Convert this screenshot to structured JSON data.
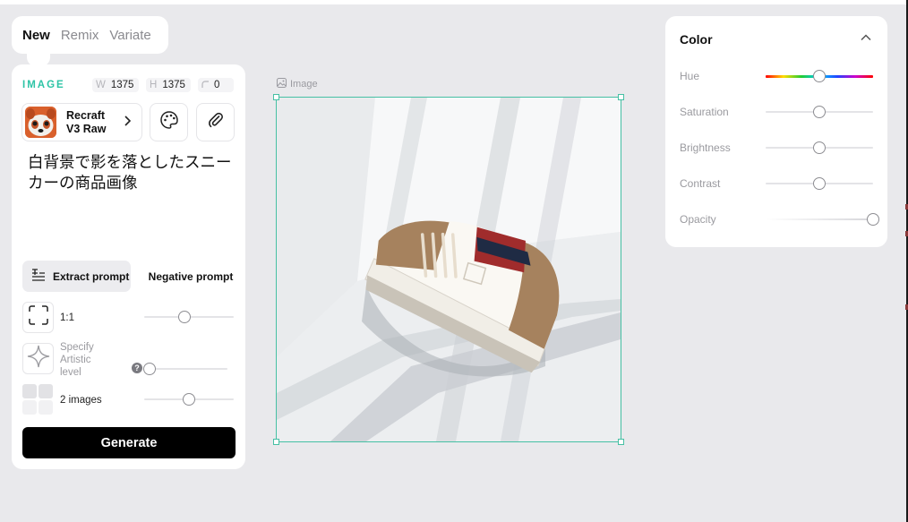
{
  "mode_tabs": [
    {
      "label": "New",
      "active": true
    },
    {
      "label": "Remix",
      "active": false
    },
    {
      "label": "Variate",
      "active": false
    }
  ],
  "image_settings": {
    "section_label": "IMAGE",
    "width_key": "W",
    "width_value": "1375",
    "height_key": "H",
    "height_value": "1375",
    "corner_value": "0"
  },
  "model": {
    "name_line1": "Recraft",
    "name_line2": "V3 Raw",
    "avatar_icon": "red-panda-avatar"
  },
  "tool_buttons": [
    {
      "icon": "palette-icon"
    },
    {
      "icon": "paperclip-icon"
    }
  ],
  "prompt_text": "白背景で影を落としたスニーカーの商品画像",
  "prompt_buttons": {
    "extract": "Extract prompt",
    "negative": "Negative prompt"
  },
  "options": {
    "aspect": {
      "label": "1:1",
      "value": 0.45
    },
    "artistic": {
      "label": "Specify Artistic level",
      "help": "?",
      "value": 0.0
    },
    "count": {
      "label": "2 images",
      "value": 0.5
    }
  },
  "generate_label": "Generate",
  "canvas": {
    "label": "Image",
    "accent": "#46c0a4"
  },
  "color_panel": {
    "title": "Color",
    "sliders": [
      {
        "name": "hue",
        "label": "Hue",
        "value": 0.5
      },
      {
        "name": "saturation",
        "label": "Saturation",
        "value": 0.5
      },
      {
        "name": "brightness",
        "label": "Brightness",
        "value": 0.5
      },
      {
        "name": "contrast",
        "label": "Contrast",
        "value": 0.5
      },
      {
        "name": "opacity",
        "label": "Opacity",
        "value": 1.0
      }
    ]
  },
  "colors": {
    "accent_teal": "#2ec4a6",
    "generate_bg": "#000000",
    "panel_bg": "#ffffff",
    "page_bg": "#e9e9ec"
  }
}
